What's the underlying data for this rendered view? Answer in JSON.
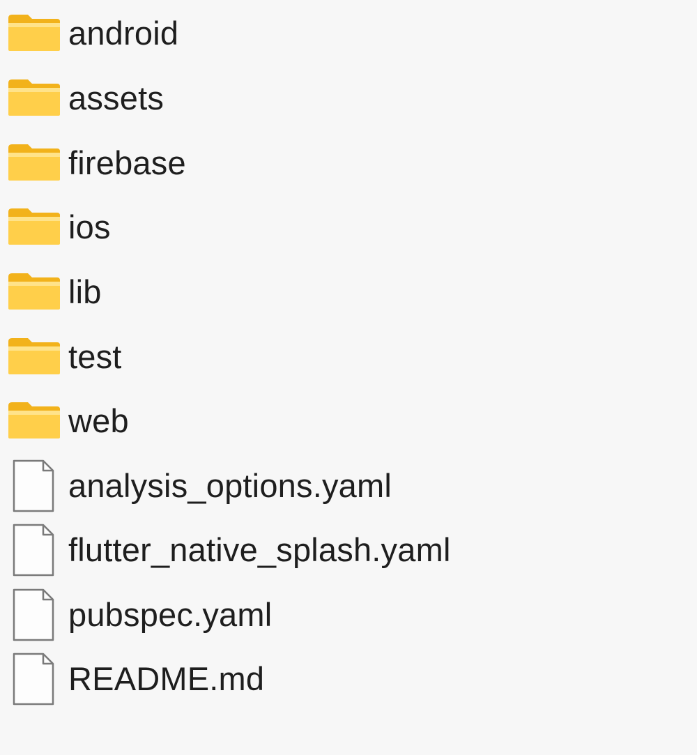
{
  "items": [
    {
      "name": "android",
      "type": "folder",
      "icon": "folder-icon"
    },
    {
      "name": "assets",
      "type": "folder",
      "icon": "folder-icon"
    },
    {
      "name": "firebase",
      "type": "folder",
      "icon": "folder-icon"
    },
    {
      "name": "ios",
      "type": "folder",
      "icon": "folder-icon"
    },
    {
      "name": "lib",
      "type": "folder",
      "icon": "folder-icon"
    },
    {
      "name": "test",
      "type": "folder",
      "icon": "folder-icon"
    },
    {
      "name": "web",
      "type": "folder",
      "icon": "folder-icon"
    },
    {
      "name": "analysis_options.yaml",
      "type": "file",
      "icon": "file-icon"
    },
    {
      "name": "flutter_native_splash.yaml",
      "type": "file",
      "icon": "file-icon"
    },
    {
      "name": "pubspec.yaml",
      "type": "file",
      "icon": "file-icon"
    },
    {
      "name": "README.md",
      "type": "file",
      "icon": "file-icon"
    }
  ],
  "colors": {
    "background": "#f7f7f7",
    "folder_front": "#ffd65c",
    "folder_back": "#f4b400",
    "file_outline": "#7a7a7a",
    "text": "#1e1e1e"
  }
}
